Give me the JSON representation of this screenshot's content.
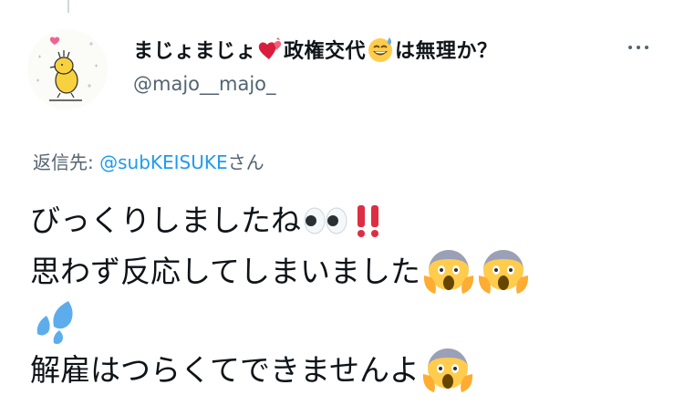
{
  "tweet": {
    "display_name_parts": [
      "まじょまじょ",
      "政権交代",
      "は無理か？"
    ],
    "handle": "@majo__majo_",
    "reply": {
      "prefix": "返信先: ",
      "mention": "@subKEISUKE",
      "suffix": "さん"
    },
    "lines": [
      "びっくりしましたね",
      "思わず反応してしまいました",
      "",
      "解雇はつらくてできませんよ"
    ],
    "icons": {
      "name_emojis": [
        "heart-with-ribbon-icon",
        "grinning-sweat-icon"
      ],
      "line1_emojis": [
        "eyes-icon",
        "double-exclamation-icon"
      ],
      "line2_emojis": [
        "screaming-face-icon",
        "screaming-face-icon"
      ],
      "line3_emojis": [
        "sweat-droplets-icon"
      ],
      "line4_emojis": [
        "screaming-face-icon"
      ],
      "avatar": "woodstock-avatar-icon",
      "more": "more-options-icon"
    },
    "colors": {
      "link": "#1d9bf0",
      "secondary_text": "#536471",
      "primary_text": "#0f1419"
    }
  }
}
